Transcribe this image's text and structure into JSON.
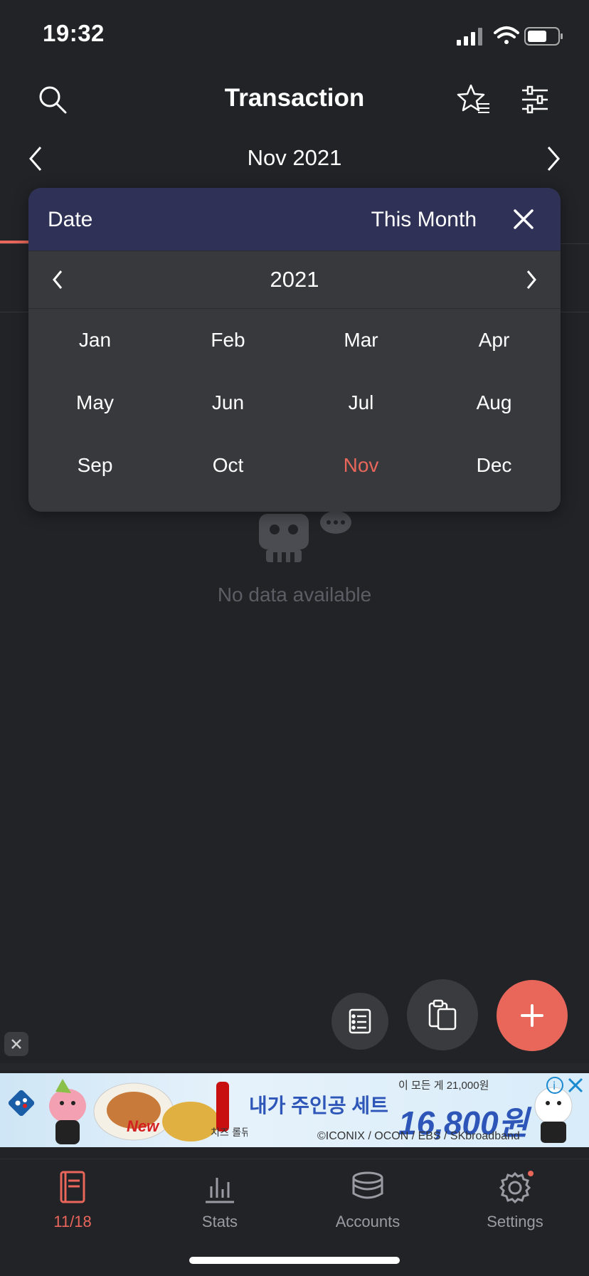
{
  "status_bar": {
    "time": "19:32"
  },
  "header": {
    "title": "Transaction"
  },
  "month_nav": {
    "label": "Nov 2021"
  },
  "empty_state": {
    "text": "No data available"
  },
  "date_popup": {
    "title": "Date",
    "range_label": "This Month",
    "year": "2021",
    "months": [
      "Jan",
      "Feb",
      "Mar",
      "Apr",
      "May",
      "Jun",
      "Jul",
      "Aug",
      "Sep",
      "Oct",
      "Nov",
      "Dec"
    ],
    "selected_month": "Nov"
  },
  "ad": {
    "headline": "내가 주인공 세트",
    "price": "16,800원",
    "small_text": "이 모든 게 21,000원",
    "credit": "©ICONIX / OCON / EBS / SKbroadband",
    "new_label": "New"
  },
  "bottom_nav": {
    "items": [
      {
        "label": "11/18",
        "icon": "book-icon"
      },
      {
        "label": "Stats",
        "icon": "bar-chart-icon"
      },
      {
        "label": "Accounts",
        "icon": "coins-icon"
      },
      {
        "label": "Settings",
        "icon": "gear-icon"
      }
    ]
  },
  "colors": {
    "accent": "#e8665a",
    "popup_header": "#2f3256",
    "background": "#222327"
  }
}
